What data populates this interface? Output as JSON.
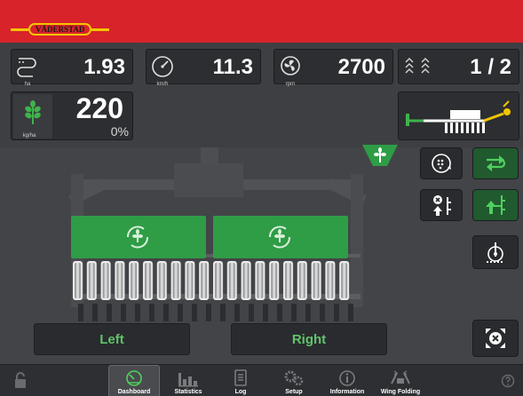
{
  "header": {
    "logo_text": "VÄDERSTAD"
  },
  "stats": {
    "area": {
      "value": "1.93",
      "unit": "ha",
      "icon": "area-counter-icon"
    },
    "speed": {
      "value": "11.3",
      "unit": "km/h",
      "icon": "speedometer-icon"
    },
    "fan": {
      "value": "2700",
      "unit": "rpm",
      "icon": "fan-icon"
    },
    "tramline": {
      "value": "1 / 2",
      "icon": "tramline-icon"
    }
  },
  "seed_rate": {
    "value": "220",
    "percent": "0%",
    "unit": "kg/ha",
    "icon": "seed-icon"
  },
  "machine": {
    "icon": "drill-side-view-icon"
  },
  "sides": {
    "left_label": "Left",
    "right_label": "Right"
  },
  "nav": {
    "items": [
      {
        "label": "Dashboard",
        "icon": "dashboard-icon",
        "selected": true
      },
      {
        "label": "Statistics",
        "icon": "statistics-icon"
      },
      {
        "label": "Log",
        "icon": "log-icon"
      },
      {
        "label": "Setup",
        "icon": "setup-gears-icon"
      },
      {
        "label": "Information",
        "icon": "information-icon"
      },
      {
        "label": "Wing Folding",
        "icon": "wing-folding-icon"
      }
    ]
  },
  "colors": {
    "header_red": "#d8232a",
    "accent_green": "#2f9c46",
    "logo_yellow": "#f2c500"
  }
}
